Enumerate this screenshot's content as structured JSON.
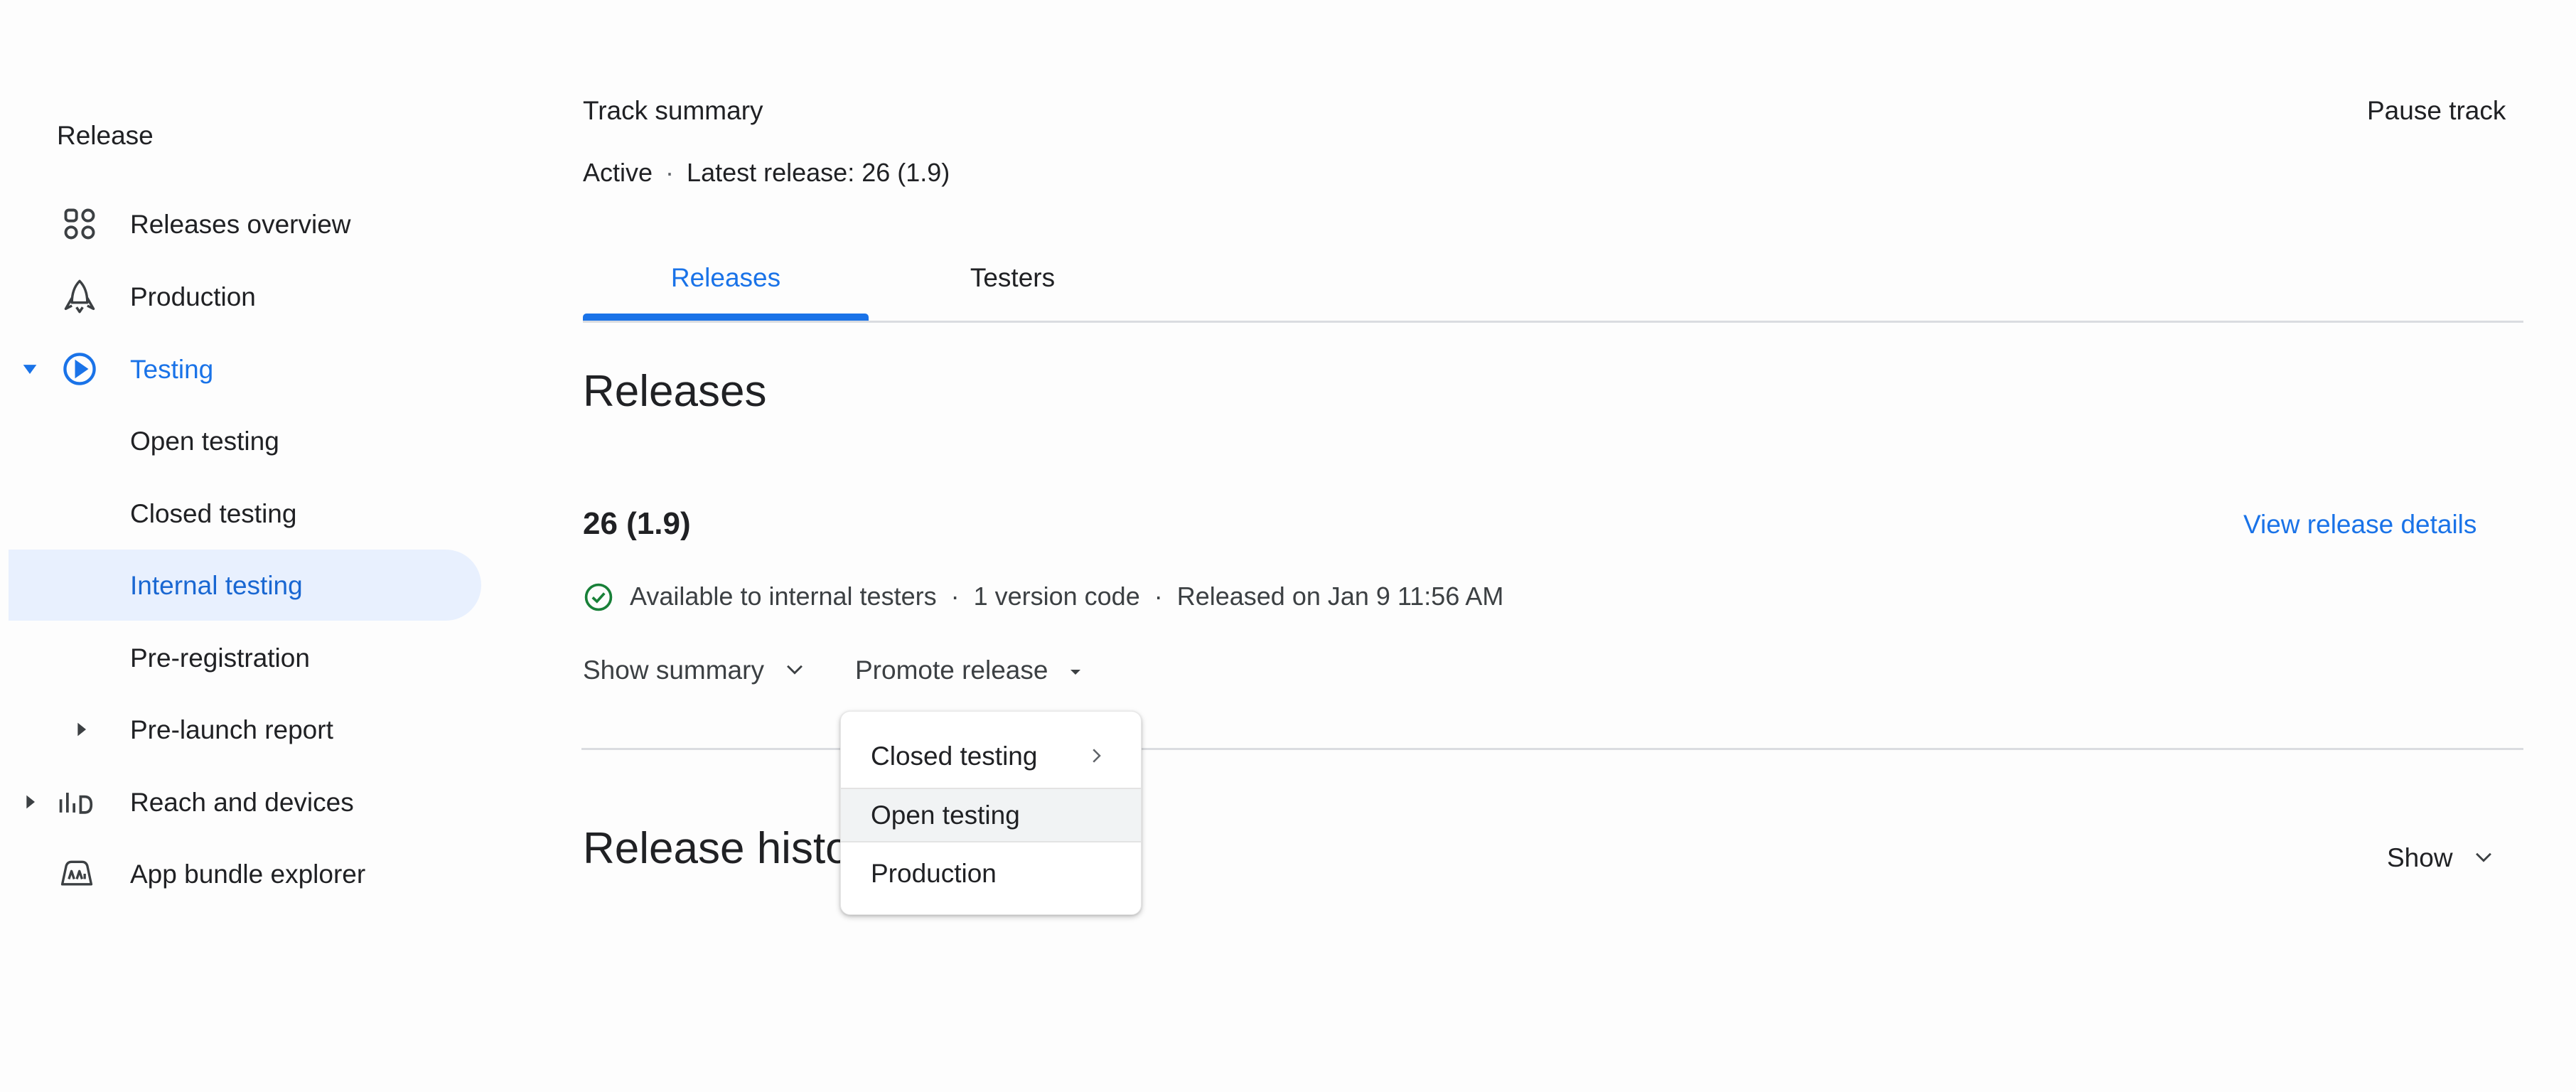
{
  "sidebar": {
    "title": "Release",
    "items": [
      {
        "label": "Releases overview",
        "icon": "grid-icon"
      },
      {
        "label": "Production",
        "icon": "rocket-icon"
      },
      {
        "label": "Testing",
        "icon": "testing-play-icon",
        "expanded": true
      },
      {
        "label": "Open testing"
      },
      {
        "label": "Closed testing"
      },
      {
        "label": "Internal testing",
        "selected": true
      },
      {
        "label": "Pre-registration"
      },
      {
        "label": "Pre-launch report",
        "expandable": true
      },
      {
        "label": "Reach and devices",
        "icon": "bar-chart-icon",
        "expandable": true
      },
      {
        "label": "App bundle explorer",
        "icon": "app-bundle-icon"
      }
    ]
  },
  "header": {
    "title": "Track summary",
    "status": "Active",
    "separator": "·",
    "latest_release": "Latest release: 26 (1.9)",
    "pause_button": "Pause track"
  },
  "tabs": [
    {
      "label": "Releases",
      "active": true
    },
    {
      "label": "Testers",
      "active": false
    }
  ],
  "releases": {
    "heading": "Releases",
    "version": "26 (1.9)",
    "view_details": "View release details",
    "availability": "Available to internal testers",
    "version_codes": "1 version code",
    "released_on": "Released on Jan 9 11:56 AM",
    "separator": "·",
    "show_summary": "Show summary",
    "promote_release": "Promote release"
  },
  "promote_menu": {
    "items": [
      {
        "label": "Closed testing",
        "has_submenu": true
      },
      {
        "label": "Open testing",
        "hovered": true
      },
      {
        "label": "Production"
      }
    ]
  },
  "history": {
    "heading": "Release history",
    "show_button": "Show"
  },
  "colors": {
    "accent": "#1a73e8",
    "selected_bg": "#e8f0fe",
    "success": "#188038",
    "divider": "#dadce0"
  }
}
